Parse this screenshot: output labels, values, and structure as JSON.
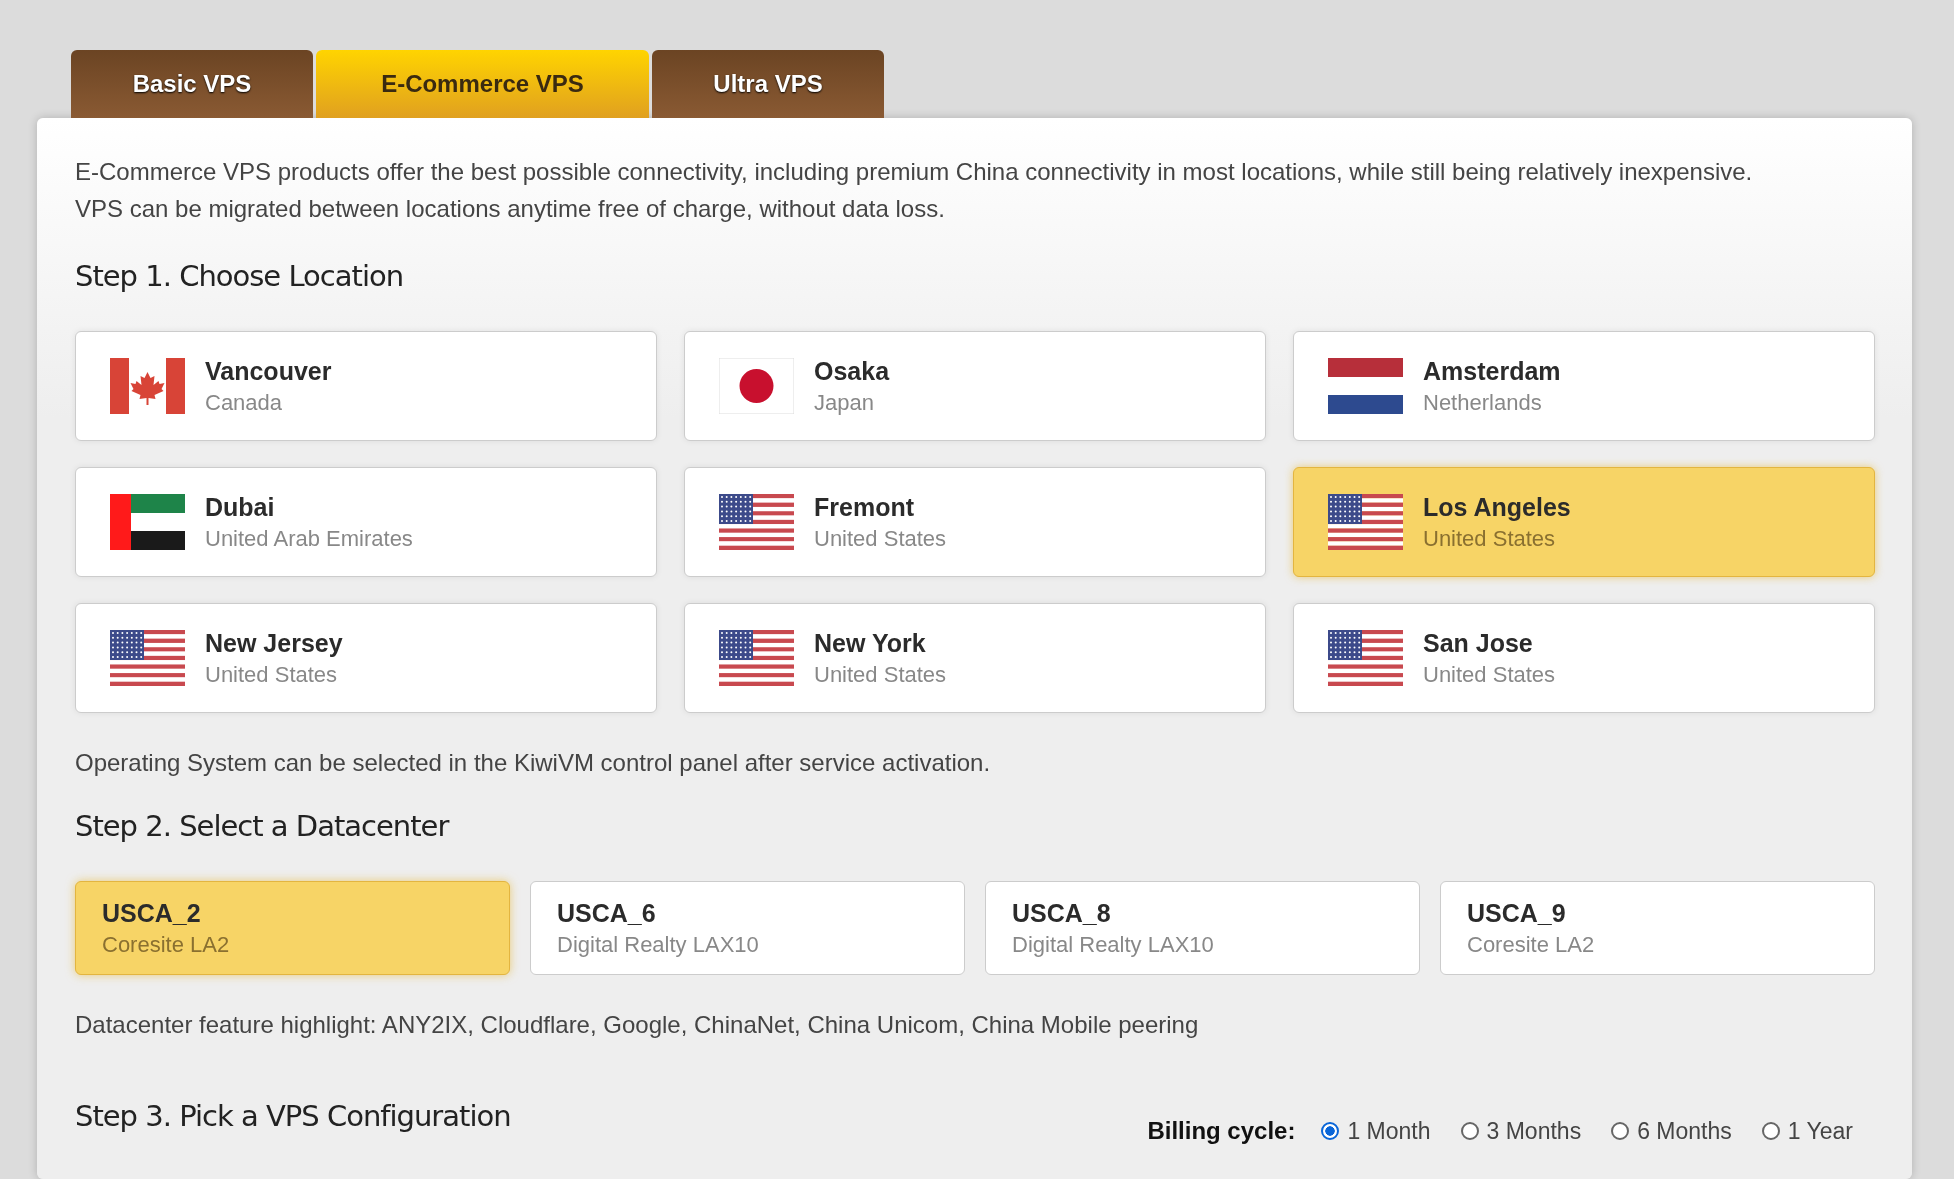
{
  "tabs": [
    {
      "label": "Basic VPS",
      "selected": false
    },
    {
      "label": "E-Commerce VPS",
      "selected": true
    },
    {
      "label": "Ultra VPS",
      "selected": false
    }
  ],
  "description": "E-Commerce VPS products offer the best possible connectivity, including premium China connectivity in most locations, while still being relatively inexpensive. VPS can be migrated between locations anytime free of charge, without data loss.",
  "step1": {
    "heading": "Step 1. Choose Location",
    "locations": [
      {
        "city": "Vancouver",
        "country": "Canada",
        "kind": "canada",
        "selected": false
      },
      {
        "city": "Osaka",
        "country": "Japan",
        "kind": "japan",
        "selected": false
      },
      {
        "city": "Amsterdam",
        "country": "Netherlands",
        "kind": "netherlands",
        "selected": false
      },
      {
        "city": "Dubai",
        "country": "United Arab Emirates",
        "kind": "uae",
        "selected": false
      },
      {
        "city": "Fremont",
        "country": "United States",
        "kind": "usa",
        "selected": false
      },
      {
        "city": "Los Angeles",
        "country": "United States",
        "kind": "usa",
        "selected": true
      },
      {
        "city": "New Jersey",
        "country": "United States",
        "kind": "usa",
        "selected": false
      },
      {
        "city": "New York",
        "country": "United States",
        "kind": "usa",
        "selected": false
      },
      {
        "city": "San Jose",
        "country": "United States",
        "kind": "usa",
        "selected": false
      }
    ],
    "note": "Operating System can be selected in the KiwiVM control panel after service activation."
  },
  "step2": {
    "heading": "Step 2. Select a Datacenter",
    "datacenters": [
      {
        "code": "USCA_2",
        "name": "Coresite LA2",
        "selected": true
      },
      {
        "code": "USCA_6",
        "name": "Digital Realty LAX10",
        "selected": false
      },
      {
        "code": "USCA_8",
        "name": "Digital Realty LAX10",
        "selected": false
      },
      {
        "code": "USCA_9",
        "name": "Coresite LA2",
        "selected": false
      }
    ],
    "note": "Datacenter feature highlight: ANY2IX, Cloudflare, Google, ChinaNet, China Unicom, China Mobile peering"
  },
  "step3": {
    "heading": "Step 3. Pick a VPS Configuration",
    "billing_label": "Billing cycle:",
    "billing_options": [
      {
        "label": "1 Month",
        "selected": true
      },
      {
        "label": "3 Months",
        "selected": false
      },
      {
        "label": "6 Months",
        "selected": false
      },
      {
        "label": "1 Year",
        "selected": false
      }
    ]
  }
}
